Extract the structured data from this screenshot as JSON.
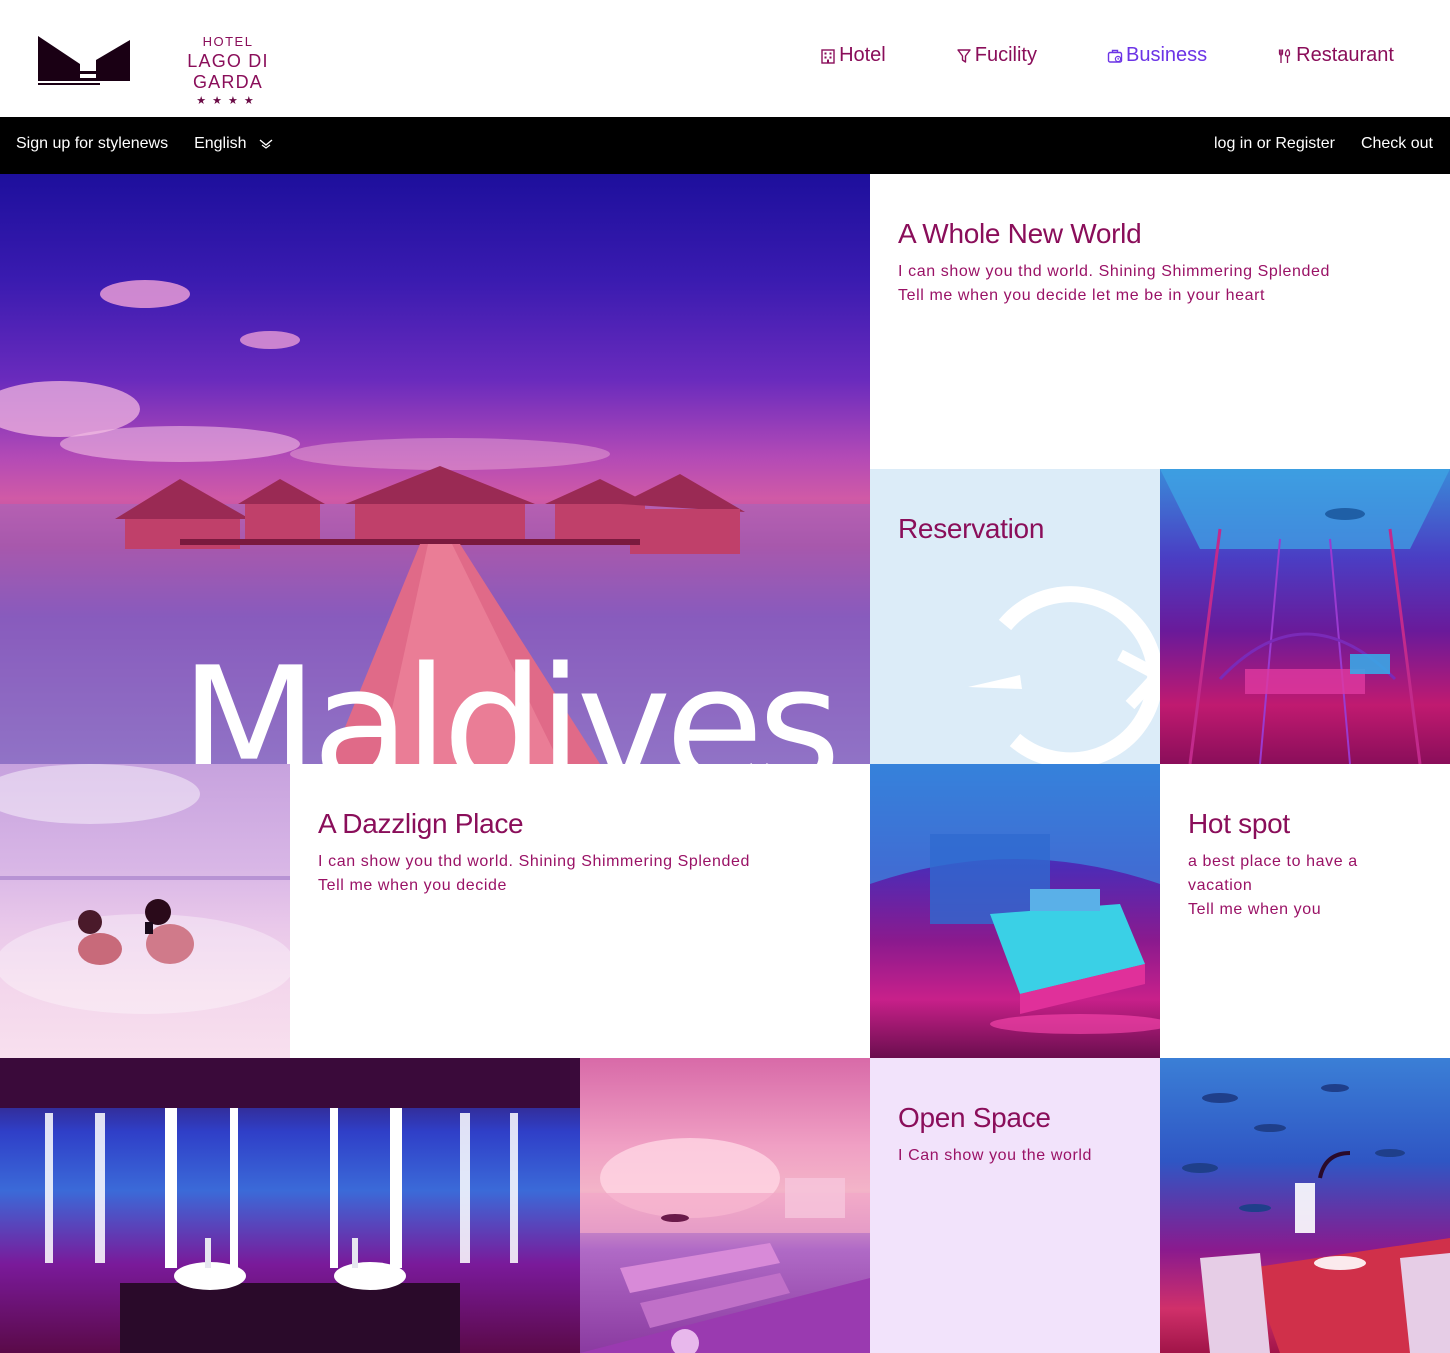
{
  "brand": {
    "sub": "HOTEL",
    "name": "LAGO DI GARDA",
    "stars": "★★★★"
  },
  "nav": [
    {
      "label": "Hotel",
      "icon": "building-icon",
      "active": false
    },
    {
      "label": "Fucility",
      "icon": "filter-icon",
      "active": false
    },
    {
      "label": "Business",
      "icon": "briefcase-icon",
      "active": true
    },
    {
      "label": "Restaurant",
      "icon": "cutlery-icon",
      "active": false
    }
  ],
  "utility": {
    "newsletter": "Sign up for stylenews",
    "language": "English",
    "login": "log in or Register",
    "checkout": "Check out"
  },
  "hero": {
    "word": "Maldives"
  },
  "tiles": {
    "whole_world": {
      "title": "A Whole New World",
      "line1": "I can show you thd world. Shining Shimmering Splended",
      "line2": "Tell me when you decide let me be in your heart"
    },
    "reservation": {
      "title": "Reservation"
    },
    "dazzling": {
      "title": "A Dazzlign Place",
      "line1": "I can show you thd world. Shining Shimmering Splended",
      "line2": "Tell me when you decide"
    },
    "hotspot": {
      "title": "Hot spot",
      "line1": "a best place to have a vacation",
      "line2": "Tell me when you"
    },
    "open_space": {
      "title": "Open Space",
      "line1": "I Can show you the world"
    }
  },
  "colors": {
    "accent": "#8a0e5a",
    "active": "#6c34e6",
    "bar": "#000000",
    "reservation_bg": "#dcecf8",
    "open_space_bg": "#f2e3fb"
  }
}
